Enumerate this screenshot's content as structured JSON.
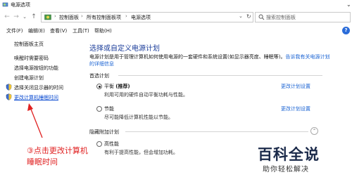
{
  "window": {
    "title": "电源选项",
    "collapse_glyph": "⌄"
  },
  "address_bar": {
    "back_icon": "←",
    "forward_icon": "→",
    "recent_icon": "⌄",
    "up_icon": "↑",
    "breadcrumbs": [
      "控制面板",
      "所有控制面板项",
      "电源选项"
    ],
    "separator": "›",
    "dropdown_icon": "⌄",
    "refresh_icon": "↻"
  },
  "search": {
    "placeholder": "搜索控制面板"
  },
  "menubar": {
    "items": [
      "文件(F)",
      "编辑(E)",
      "查看(V)",
      "工具(T)",
      "帮助(H)"
    ],
    "help_glyph": "?"
  },
  "sidebar": {
    "items": [
      {
        "label": "控制面板主页"
      },
      {
        "label": "唤醒时需要密码"
      },
      {
        "label": "选择电源按钮的功能"
      },
      {
        "label": "创建电源计划"
      },
      {
        "label": "选择关闭显示器的时间"
      },
      {
        "label": "更改计算机睡眠时间"
      }
    ]
  },
  "main": {
    "title": "选择或自定义电源计划",
    "description": "电源计划是用于管理计算机如何使用电源的一套硬件和系统设置(如显示器亮度、睡眠等)。",
    "description_link": "告诉我有关电源计划",
    "description_link2": "的详细信息",
    "preferred_section": "首选计划",
    "hidden_section": "隐藏附加计划",
    "plans": [
      {
        "name": "平衡",
        "tag": "(推荐)",
        "desc": "利用可用的硬件自动平衡功耗与性能。",
        "link": "更改计划设置",
        "checked": true
      },
      {
        "name": "节能",
        "tag": "",
        "desc": "尽可能降低计算机性能以节能。",
        "link": "更改计划设置",
        "checked": false
      },
      {
        "name": "高性能",
        "tag": "",
        "desc": "有利于提高性能，但会增加功耗。",
        "link": "",
        "checked": false
      }
    ]
  },
  "annotation": {
    "line1": "③点击更改计算机",
    "line2": "睡眠时间",
    "color": "#e02020"
  },
  "watermark": {
    "title": "百科全说",
    "subtitle": "助你轻松解决"
  },
  "colors": {
    "link": "#1862d3",
    "title": "#1b3d9a",
    "active_link": "#0b4bd1"
  }
}
